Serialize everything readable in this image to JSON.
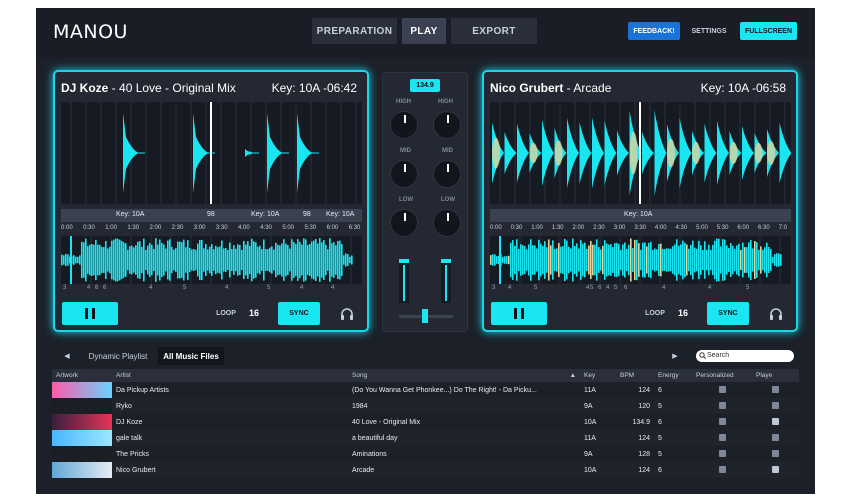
{
  "app": {
    "title": "MANOU"
  },
  "nav": {
    "tabs": [
      "PREPARATION",
      "PLAY",
      "EXPORT"
    ],
    "active": "PLAY"
  },
  "header_buttons": {
    "feedback": "FEEDBACK!",
    "settings": "SETTINGS",
    "fullscreen": "FULLSCREEN"
  },
  "colors": {
    "accent": "#19e6f0",
    "background": "#1c2029",
    "feedback": "#1a73d8"
  },
  "deck_a": {
    "artist": "DJ Koze",
    "title": "40 Love - Original Mix",
    "key": "Key: 10A",
    "time": "-06:42",
    "keybar": [
      "Key: 10A",
      "98",
      "Key: 10A",
      "98",
      "Key: 10A"
    ],
    "timeline": [
      "0:00",
      "0:30",
      "1:00",
      "1:30",
      "2:00",
      "2:30",
      "3:00",
      "3:30",
      "4:00",
      "4:30",
      "5:00",
      "5:30",
      "6:00",
      "6:30"
    ],
    "cues": [
      "3",
      "4",
      "6",
      "6",
      "4",
      "5",
      "4",
      "5",
      "4",
      "4"
    ],
    "loop_label": "LOOP",
    "loop_beats": "16",
    "sync_label": "SYNC"
  },
  "deck_b": {
    "artist": "Nico Grubert",
    "title": "Arcade",
    "key": "Key: 10A",
    "time": "-06:58",
    "keybar": [
      "Key: 10A"
    ],
    "timeline": [
      "0:00",
      "0:30",
      "1:00",
      "1:30",
      "2:00",
      "2:30",
      "3:00",
      "3:30",
      "4:00",
      "4:30",
      "5:00",
      "5:30",
      "6:00",
      "6:30",
      "7:0"
    ],
    "cues": [
      "3",
      "4",
      "5",
      "4",
      "5",
      "6",
      "4",
      "5",
      "6",
      "4",
      "4",
      "5"
    ],
    "loop_label": "LOOP",
    "loop_beats": "16",
    "sync_label": "SYNC"
  },
  "mixer": {
    "bpm": "134.9",
    "bands": [
      "HIGH",
      "MID",
      "LOW"
    ]
  },
  "browser": {
    "tabs": [
      "Dynamic Playlist",
      "All Music Files"
    ],
    "active_tab": "All Music Files",
    "search_placeholder": "Search",
    "columns": [
      "Artwork",
      "Artist",
      "Song",
      "Key",
      "BPM",
      "Energy",
      "Personalized",
      "Playe"
    ],
    "rows": [
      {
        "artist": "Da Pickup Artists",
        "song": "(Do You Wanna Get Phonkee...) Do The Right! - Da Picku...",
        "key": "11A",
        "bpm": "124",
        "energy": "6",
        "personalized": false,
        "played": false
      },
      {
        "artist": "Ryko",
        "song": "1984",
        "key": "9A",
        "bpm": "120",
        "energy": "5",
        "personalized": false,
        "played": false
      },
      {
        "artist": "DJ Koze",
        "song": "40 Love - Original Mix",
        "key": "10A",
        "bpm": "134.9",
        "energy": "6",
        "personalized": false,
        "played": true
      },
      {
        "artist": "gale talk",
        "song": "a beautiful day",
        "key": "11A",
        "bpm": "124",
        "energy": "5",
        "personalized": false,
        "played": false
      },
      {
        "artist": "The Pricks",
        "song": "Aminations",
        "key": "9A",
        "bpm": "128",
        "energy": "5",
        "personalized": false,
        "played": false
      },
      {
        "artist": "Nico Grubert",
        "song": "Arcade",
        "key": "10A",
        "bpm": "124",
        "energy": "6",
        "personalized": false,
        "played": true
      }
    ]
  }
}
